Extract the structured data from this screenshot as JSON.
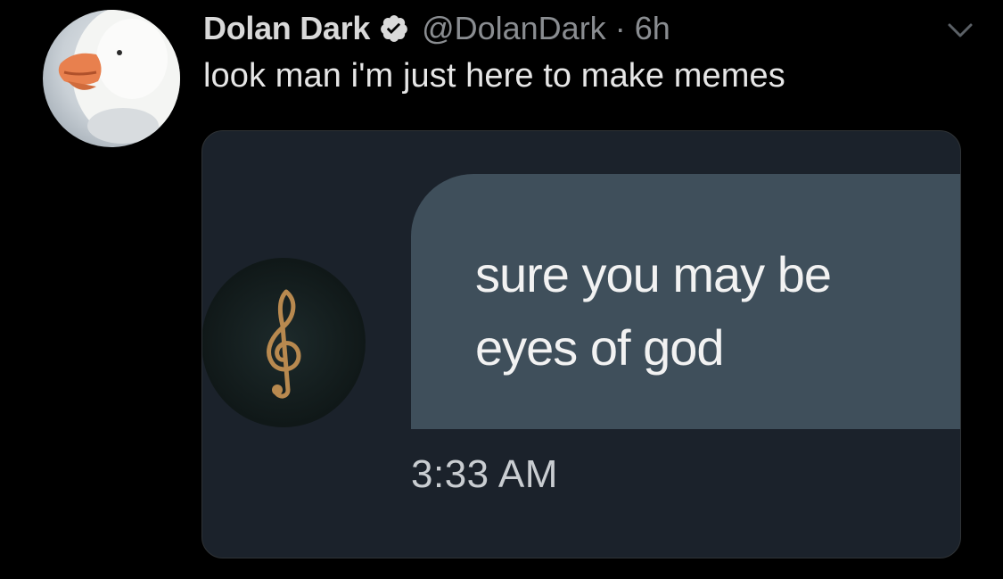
{
  "tweet": {
    "display_name": "Dolan Dark",
    "handle": "@DolanDark",
    "separator": "·",
    "time": "6h",
    "text": "look man i'm just here to make memes",
    "verified_icon": "verified-badge-icon",
    "menu_icon": "chevron-down-icon"
  },
  "media": {
    "message_lines": [
      "sure you may be",
      "eyes of god"
    ],
    "message_time": "3:33 AM",
    "avatar_icon": "treble-clef-icon"
  },
  "colors": {
    "background": "#000000",
    "card": "#1b222b",
    "bubble": "#3f4f5b",
    "handle_gray": "#8a8d91"
  }
}
